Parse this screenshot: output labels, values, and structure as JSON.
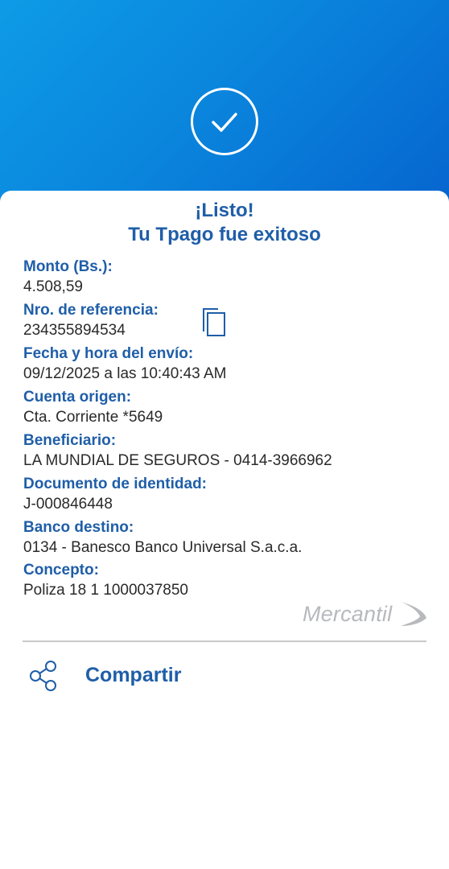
{
  "header": {
    "status_icon": "check-circle-icon"
  },
  "card": {
    "title_line1": "¡Listo!",
    "title_line2": "Tu Tpago fue exitoso",
    "fields": [
      {
        "label": "Monto (Bs.):",
        "value": "4.508,59"
      },
      {
        "label": "Nro. de referencia:",
        "value": "234355894534"
      },
      {
        "label": "Fecha y hora del envío:",
        "value": "09/12/2025 a las 10:40:43 AM"
      },
      {
        "label": "Cuenta origen:",
        "value": "Cta. Corriente *5649"
      },
      {
        "label": "Beneficiario:",
        "value": "LA MUNDIAL DE SEGUROS - 0414-3966962"
      },
      {
        "label": "Documento de identidad:",
        "value": "J-000846448"
      },
      {
        "label": "Banco destino:",
        "value": "0134 - Banesco Banco Universal S.a.c.a."
      },
      {
        "label": "Concepto:",
        "value": "Poliza 18 1 1000037850"
      }
    ],
    "copy_icon": "copy-icon",
    "brand": "Mercantil"
  },
  "share": {
    "label": "Compartir",
    "icon": "share-icon"
  },
  "colors": {
    "accent": "#1f5ea8",
    "header_start": "#0e9be6",
    "header_end": "#0665cf"
  }
}
